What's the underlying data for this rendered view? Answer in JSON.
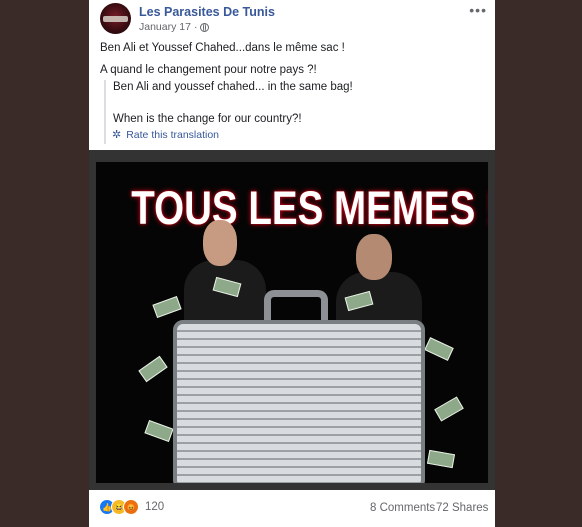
{
  "post": {
    "page_name": "Les Parasites De Tunis",
    "date": "January 17",
    "date_separator": "·",
    "more_icon": "more-horizontal-icon",
    "text_lines": [
      "Ben Ali et Youssef Chahed...dans le même sac !",
      "A quand le changement pour notre pays ?!"
    ],
    "translation_lines": [
      "Ben Ali and youssef chahed... in the same bag!",
      "When is the change for our country?!"
    ],
    "rate_translation": "Rate this translation"
  },
  "image": {
    "caption_text": "TOUS LES MEMES !"
  },
  "footer": {
    "reaction_icons": [
      "like-icon",
      "haha-icon",
      "angry-icon"
    ],
    "reaction_count": "120",
    "comments": "8 Comments",
    "shares": "72 Shares"
  },
  "colors": {
    "link_blue": "#385898",
    "background": "#3a2a28",
    "card": "#ffffff"
  }
}
